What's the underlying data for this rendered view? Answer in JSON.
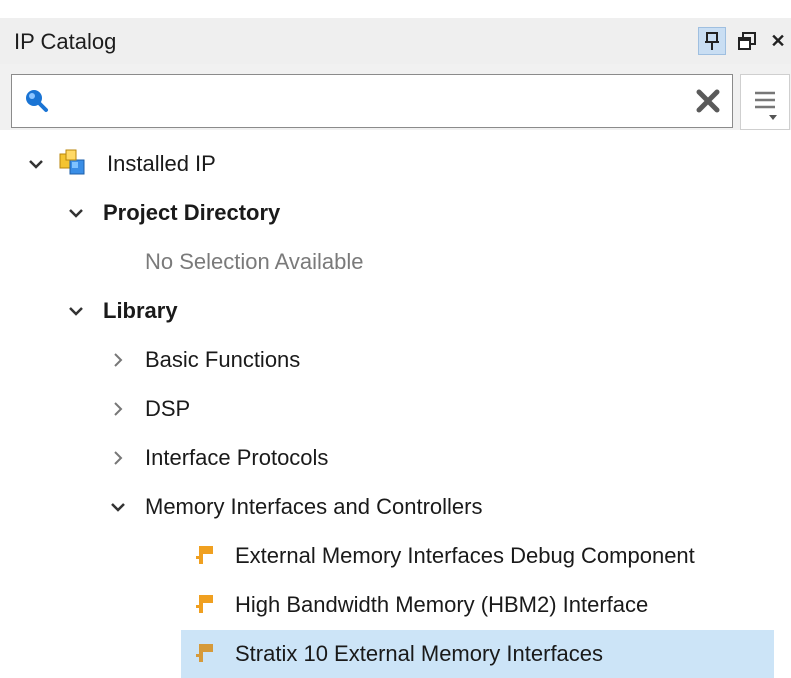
{
  "panel": {
    "title": "IP Catalog",
    "icons": [
      "pin-icon",
      "float-window-icon",
      "close-icon"
    ]
  },
  "search": {
    "value": "",
    "placeholder": ""
  },
  "tree": {
    "installed_ip": "Installed IP",
    "project_directory": "Project Directory",
    "no_selection": "No Selection Available",
    "library": "Library",
    "basic_functions": "Basic Functions",
    "dsp": "DSP",
    "interface_protocols": "Interface Protocols",
    "memory_interfaces": "Memory Interfaces and Controllers",
    "items": [
      "External Memory Interfaces Debug Component",
      "High Bandwidth Memory (HBM2) Interface",
      "Stratix 10 External Memory Interfaces"
    ]
  },
  "colors": {
    "selection": "#cce4f7",
    "ip_icon": "#f0a020",
    "search_icon": "#1a74d4"
  }
}
